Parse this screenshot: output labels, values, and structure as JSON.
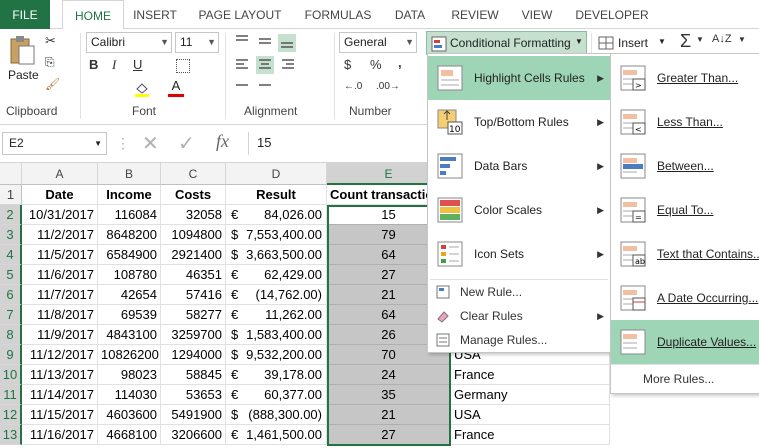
{
  "tabs": [
    "FILE",
    "HOME",
    "INSERT",
    "PAGE LAYOUT",
    "FORMULAS",
    "DATA",
    "REVIEW",
    "VIEW",
    "DEVELOPER"
  ],
  "ribbon": {
    "clipboard_label": "Clipboard",
    "paste_label": "Paste",
    "font_label": "Font",
    "font_name": "Calibri",
    "font_size": "11",
    "alignment_label": "Alignment",
    "number_label": "Number",
    "number_format": "General",
    "cf_label": "Conditional Formatting",
    "insert_label": "Insert",
    "bold": "B",
    "italic": "I",
    "underline": "U",
    "currency": "$",
    "percent": "%",
    "comma": ",",
    "sigma": "Σ"
  },
  "formula_bar": {
    "name_box": "E2",
    "fx": "fx",
    "value": "15"
  },
  "columns": [
    "A",
    "B",
    "C",
    "D",
    "E"
  ],
  "headers": [
    "Date",
    "Income",
    "Costs",
    "Result",
    "Count transactio"
  ],
  "rows": [
    {
      "n": "1"
    },
    {
      "n": "2",
      "a": "10/31/2017",
      "b": "116084",
      "c": "32058",
      "dsym": "€",
      "d": "84,026.00",
      "e": "15"
    },
    {
      "n": "3",
      "a": "11/2/2017",
      "b": "8648200",
      "c": "1094800",
      "dsym": "$",
      "d": "7,553,400.00",
      "e": "79"
    },
    {
      "n": "4",
      "a": "11/5/2017",
      "b": "6584900",
      "c": "2921400",
      "dsym": "$",
      "d": "3,663,500.00",
      "e": "64"
    },
    {
      "n": "5",
      "a": "11/6/2017",
      "b": "108780",
      "c": "46351",
      "dsym": "€",
      "d": "62,429.00",
      "e": "27"
    },
    {
      "n": "6",
      "a": "11/7/2017",
      "b": "42654",
      "c": "57416",
      "dsym": "€",
      "d": "(14,762.00)",
      "e": "21"
    },
    {
      "n": "7",
      "a": "11/8/2017",
      "b": "69539",
      "c": "58277",
      "dsym": "€",
      "d": "11,262.00",
      "e": "64"
    },
    {
      "n": "8",
      "a": "11/9/2017",
      "b": "4843100",
      "c": "3259700",
      "dsym": "$",
      "d": "1,583,400.00",
      "e": "26"
    },
    {
      "n": "9",
      "a": "11/12/2017",
      "b": "10826200",
      "c": "1294000",
      "dsym": "$",
      "d": "9,532,200.00",
      "e": "70",
      "f": "USA"
    },
    {
      "n": "10",
      "a": "11/13/2017",
      "b": "98023",
      "c": "58845",
      "dsym": "€",
      "d": "39,178.00",
      "e": "24",
      "f": "France"
    },
    {
      "n": "11",
      "a": "11/14/2017",
      "b": "114030",
      "c": "53653",
      "dsym": "€",
      "d": "60,377.00",
      "e": "35",
      "f": "Germany"
    },
    {
      "n": "12",
      "a": "11/15/2017",
      "b": "4603600",
      "c": "5491900",
      "dsym": "$",
      "d": "(888,300.00)",
      "e": "21",
      "f": "USA"
    },
    {
      "n": "13",
      "a": "11/16/2017",
      "b": "4668100",
      "c": "3206600",
      "dsym": "€",
      "d": "1,461,500.00",
      "e": "27",
      "f": "France"
    }
  ],
  "cf_menu": {
    "items": [
      "Highlight Cells Rules",
      "Top/Bottom Rules",
      "Data Bars",
      "Color Scales",
      "Icon Sets"
    ],
    "small_items": [
      "New Rule...",
      "Clear Rules",
      "Manage Rules..."
    ]
  },
  "hc_submenu": {
    "items": [
      "Greater Than...",
      "Less Than...",
      "Between...",
      "Equal To...",
      "Text that Contains...",
      "A Date Occurring...",
      "Duplicate Values..."
    ],
    "more": "More Rules..."
  },
  "colors": {
    "excel_green": "#217346",
    "menu_hover": "#9fd5b7",
    "selection_gray": "#c6c6c6"
  }
}
